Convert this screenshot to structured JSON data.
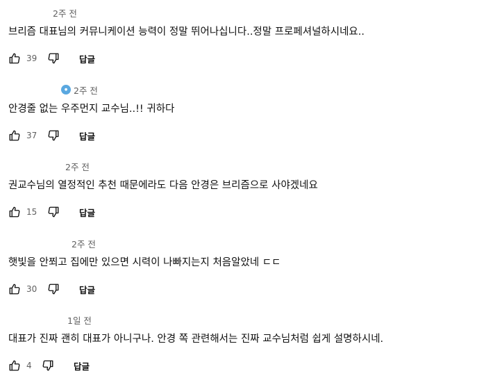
{
  "comments": [
    {
      "timestamp": "2주 전",
      "text": "브리즘 대표님의 커뮤니케이션 능력이 정말 뛰어나십니다..정말 프로페셔널하시네요..",
      "likes": "39",
      "reply_label": "답글"
    },
    {
      "timestamp": "2주 전",
      "text": "안경줄 없는 우주먼지 교수님..!! 귀하다",
      "likes": "37",
      "reply_label": "답글"
    },
    {
      "timestamp": "2주 전",
      "text": "권교수님의 열정적인 추천 때문에라도 다음 안경은 브리즘으로 사야겠네요",
      "likes": "15",
      "reply_label": "답글"
    },
    {
      "timestamp": "2주 전",
      "text": "햇빛을 안쬐고 집에만 있으면 시력이 나빠지는지 처음알았네 ㄷㄷ",
      "likes": "30",
      "reply_label": "답글"
    },
    {
      "timestamp": "1일 전",
      "text": "대표가 진짜 괜히 대표가 아니구나. 안경 쪽 관련해서는 진짜 교수님처럼 쉽게 설명하시네.",
      "likes": "4",
      "reply_label": "답글"
    }
  ],
  "icons": {
    "like": "thumbs-up-icon",
    "dislike": "thumbs-down-icon",
    "badge": "creator-badge-icon"
  },
  "colors": {
    "text": "#0f0f0f",
    "meta": "#606060",
    "badge": "#5aa8e0"
  }
}
